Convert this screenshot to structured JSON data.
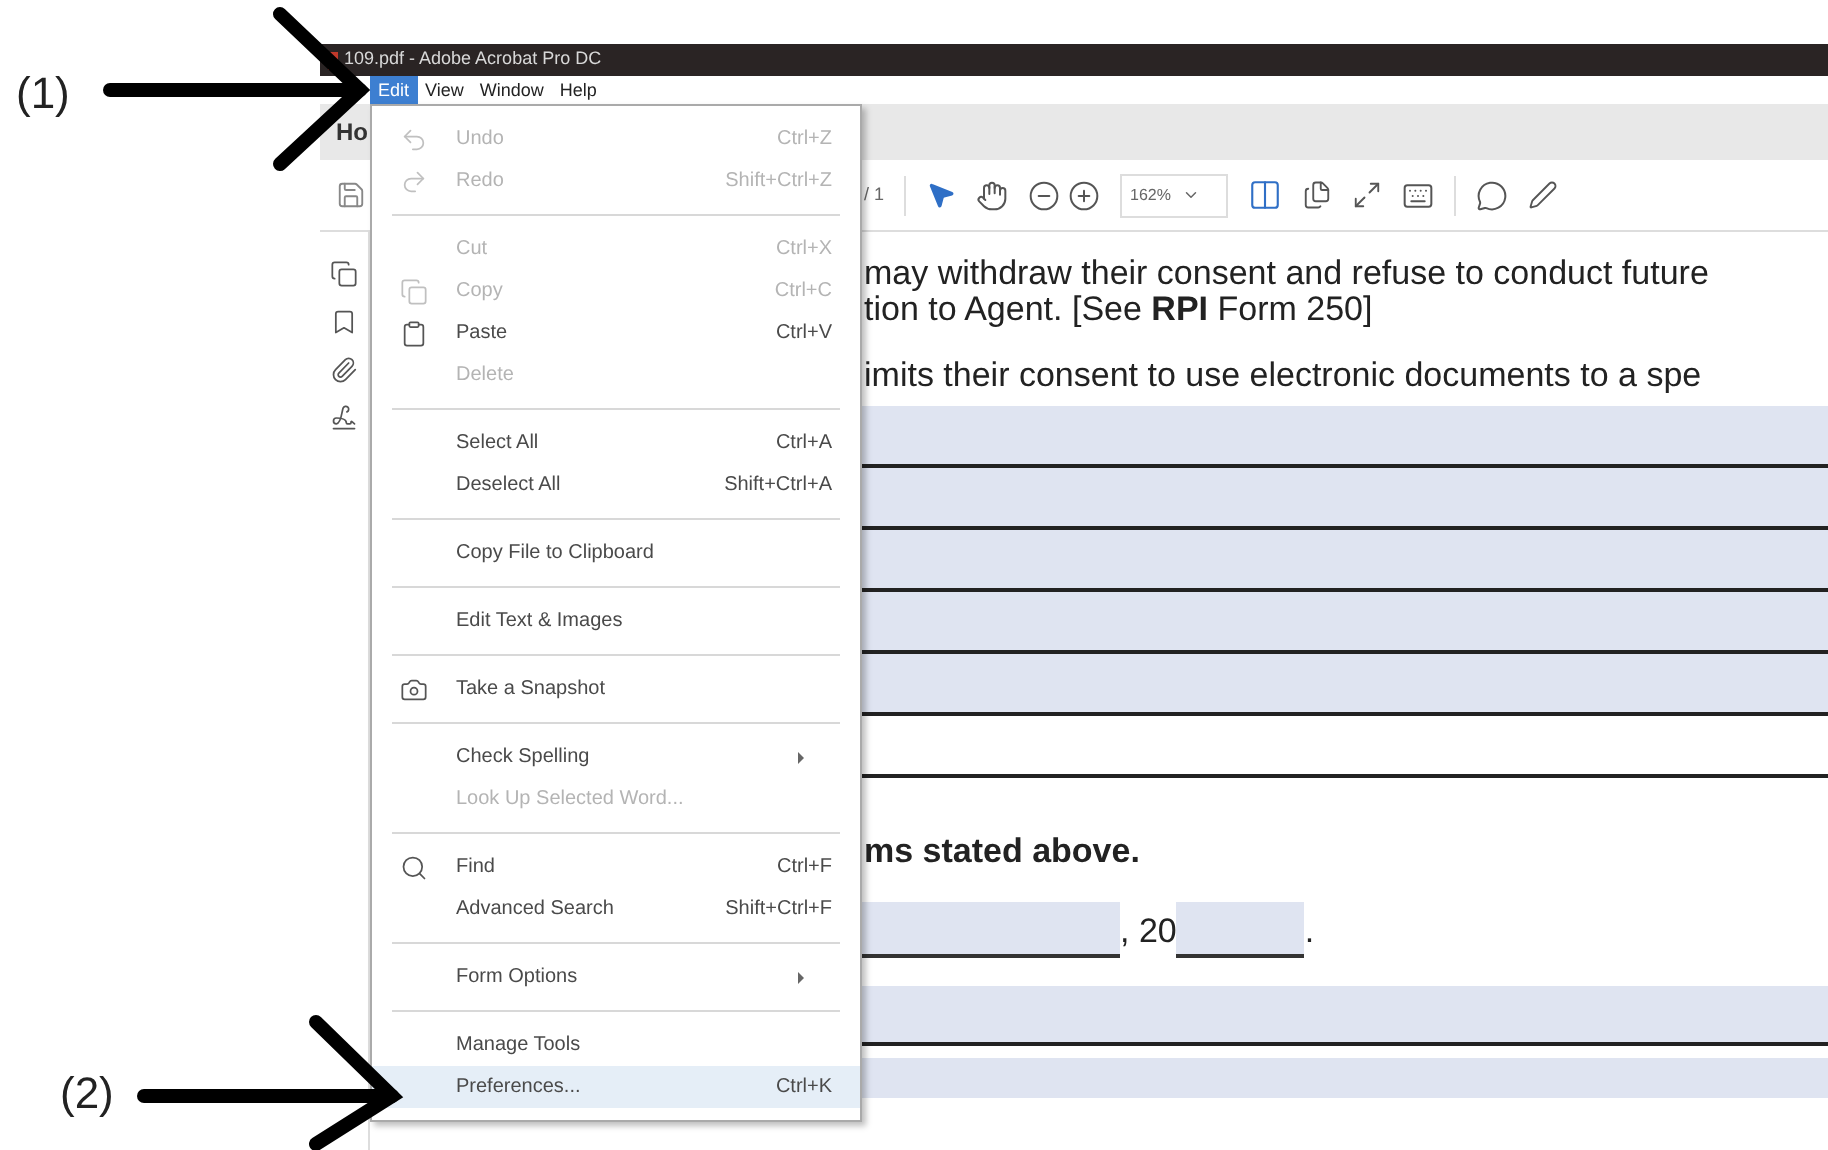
{
  "annotations": [
    {
      "label": "(1)"
    },
    {
      "label": "(2)"
    }
  ],
  "window": {
    "title": "109.pdf - Adobe Acrobat Pro DC"
  },
  "menu_bar": [
    {
      "label": "Edit",
      "selected": true
    },
    {
      "label": "View",
      "selected": false
    },
    {
      "label": "Window",
      "selected": false
    },
    {
      "label": "Help",
      "selected": false
    }
  ],
  "tabs": [
    {
      "label": "Ho"
    }
  ],
  "toolbar": {
    "page_total": "/ 1",
    "zoom": "162%"
  },
  "edit_menu": [
    {
      "kind": "item",
      "label": "Undo",
      "shortcut": "Ctrl+Z",
      "disabled": true,
      "submenu": false,
      "selected": false
    },
    {
      "kind": "item",
      "label": "Redo",
      "shortcut": "Shift+Ctrl+Z",
      "disabled": true,
      "submenu": false,
      "selected": false
    },
    {
      "kind": "separator"
    },
    {
      "kind": "item",
      "label": "Cut",
      "shortcut": "Ctrl+X",
      "disabled": true,
      "submenu": false,
      "selected": false
    },
    {
      "kind": "item",
      "label": "Copy",
      "shortcut": "Ctrl+C",
      "disabled": true,
      "submenu": false,
      "selected": false
    },
    {
      "kind": "item",
      "label": "Paste",
      "shortcut": "Ctrl+V",
      "disabled": false,
      "submenu": false,
      "selected": false
    },
    {
      "kind": "item",
      "label": "Delete",
      "disabled": true,
      "submenu": false,
      "selected": false
    },
    {
      "kind": "separator"
    },
    {
      "kind": "item",
      "label": "Select All",
      "shortcut": "Ctrl+A",
      "disabled": false,
      "submenu": false,
      "selected": false
    },
    {
      "kind": "item",
      "label": "Deselect All",
      "shortcut": "Shift+Ctrl+A",
      "disabled": false,
      "submenu": false,
      "selected": false
    },
    {
      "kind": "separator"
    },
    {
      "kind": "item",
      "label": "Copy File to Clipboard",
      "disabled": false,
      "submenu": false,
      "selected": false
    },
    {
      "kind": "separator"
    },
    {
      "kind": "item",
      "label": "Edit Text & Images",
      "disabled": false,
      "submenu": false,
      "selected": false
    },
    {
      "kind": "separator"
    },
    {
      "kind": "item",
      "label": "Take a Snapshot",
      "disabled": false,
      "submenu": false,
      "selected": false
    },
    {
      "kind": "separator"
    },
    {
      "kind": "item",
      "label": "Check Spelling",
      "disabled": false,
      "submenu": true,
      "selected": false
    },
    {
      "kind": "item",
      "label": "Look Up Selected Word...",
      "disabled": true,
      "submenu": false,
      "selected": false
    },
    {
      "kind": "separator"
    },
    {
      "kind": "item",
      "label": "Find",
      "shortcut": "Ctrl+F",
      "disabled": false,
      "submenu": false,
      "selected": false
    },
    {
      "kind": "item",
      "label": "Advanced Search",
      "shortcut": "Shift+Ctrl+F",
      "disabled": false,
      "submenu": false,
      "selected": false
    },
    {
      "kind": "separator"
    },
    {
      "kind": "item",
      "label": "Form Options",
      "disabled": false,
      "submenu": true,
      "selected": false
    },
    {
      "kind": "separator"
    },
    {
      "kind": "item",
      "label": "Manage Tools",
      "disabled": false,
      "submenu": false,
      "selected": false
    },
    {
      "kind": "item",
      "label": "Preferences...",
      "shortcut": "Ctrl+K",
      "disabled": false,
      "submenu": false,
      "selected": true
    }
  ],
  "document": {
    "lines": [
      "may withdraw their consent and refuse to conduct future",
      "tion to Agent. [See **RPI** Form 250]",
      "imits their consent to use electronic documents to a spe"
    ],
    "heading": "ms stated above.",
    "date_separator": ", 20",
    "date_end": "."
  }
}
